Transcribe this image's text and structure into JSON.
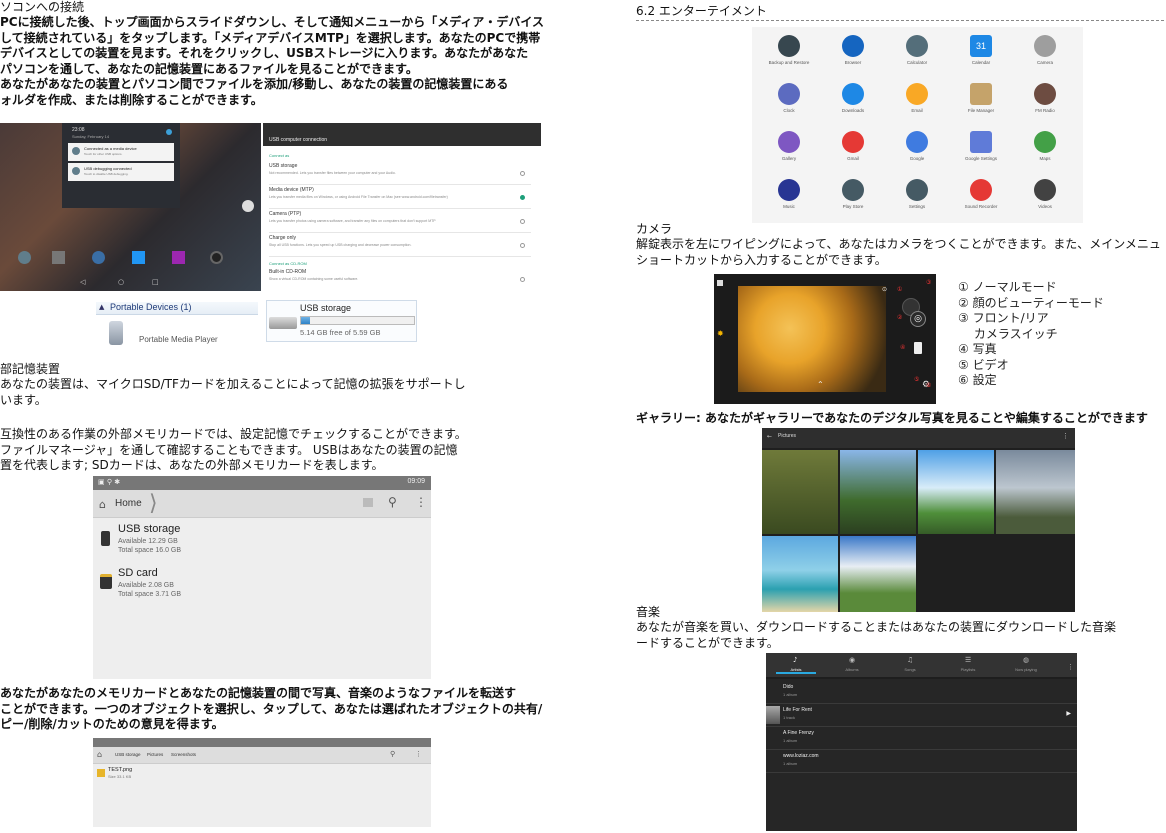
{
  "left": {
    "heading": "ソコンへの接続",
    "intro_lines": [
      "PCに接続した後、トップ画面からスライドダウンし、そして通知メニューから「メディア・デバイス",
      "して接続されている」をタップします。「メディアデバイスMTP」を選択します。あなたのPCで携帯",
      "デバイスとしての装置を見ます。それをクリックし、USBストレージに入ります。あなたがあなた",
      "パソコンを通して、あなたの記憶装置にあるファイルを見ることができます。",
      "あなたがあなたの装置とパソコン間でファイルを添加/移動し、あなたの装置の記憶装置にある",
      "ォルダを作成、または削除することができます。"
    ],
    "notif_screen": {
      "time": "23:08",
      "date": "Sunday, February 14",
      "notif1_title": "Connected as a media device",
      "notif1_sub": "Touch for other USB options.",
      "notif2_title": "USB debugging connected",
      "notif2_sub": "Touch to disable USB debugging."
    },
    "usb_screen": {
      "title": "USB computer connection",
      "section1": "Connect as",
      "options": [
        {
          "title": "USB storage",
          "sub": "Not recommended. Lets you transfer files between your computer and your Audio. ",
          "selected": false
        },
        {
          "title": "Media device (MTP)",
          "sub": "Lets you transfer media files on Windows, or using Android File Transfer on Mac (see www.android.com/filetransfer)",
          "selected": true
        },
        {
          "title": "Camera (PTP)",
          "sub": "Lets you transfer photos using camera software, and transfer any files on computers that don't support MTP",
          "selected": false
        },
        {
          "title": "Charge only",
          "sub": "Stop all USB functions. Lets you speed up USB charging and decrease power consumption.",
          "selected": false
        }
      ],
      "section2": "Connect as CD-ROM",
      "cdrom_title": "Built-in CD-ROM",
      "cdrom_sub": "Show a virtual CD-ROM containing some useful software."
    },
    "explorer": {
      "group_label": "Portable Devices (1)",
      "device_label": "Portable Media Player",
      "storage_label": "USB storage",
      "storage_free": "5.14 GB free of 5.59 GB",
      "storage_used_fraction": 0.08
    },
    "ext_heading": "部記憶装置",
    "ext_lines": [
      "あなたの装置は、マイクロSD/TFカードを加えることによって記憶の拡張をサポートし",
      "います。"
    ],
    "compat_lines": [
      "互換性のある作業の外部メモリカードでは、設定記憶でチェックすることができます。",
      "ファイルマネージャ」を通して確認することもできます。 USBはあなたの装置の記憶",
      "置を代表します; SDカードは、あなたの外部メモリカードを表します。"
    ],
    "filemgr": {
      "status_time": "09:09",
      "home_label": "Home",
      "usb_title": "USB storage",
      "usb_avail": "Available 12.29 GB",
      "usb_total": "Total space 16.0 GB",
      "sd_title": "SD card",
      "sd_avail": "Available 2.08 GB",
      "sd_total": "Total space 3.71 GB"
    },
    "transfer_lines": [
      "あなたがあなたのメモリカードとあなたの記憶装置の間で写真、音楽のようなファイルを転送す",
      "ことができます。一つのオブジェクトを選択し、タップして、あなたは選ばれたオブジェクトの共有/",
      "ピー/削除/カットのための意見を得ます。"
    ],
    "filemgr2": {
      "crumbs": [
        "USB storage",
        "Pictures",
        "Screenshots"
      ],
      "file_name": "TEST.png",
      "file_size": "Size 33.1 KB"
    }
  },
  "right": {
    "section_title": "6.2 エンターテイメント",
    "apps": [
      "Backup and Restore",
      "Browser",
      "Calculator",
      "Calendar",
      "Camera",
      "Clock",
      "Downloads",
      "Email",
      "File Manager",
      "FM Radio",
      "Gallery",
      "Gmail",
      "Google",
      "Google Settings",
      "Maps",
      "Music",
      "Play Store",
      "Settings",
      "Sound Recorder",
      "Videos"
    ],
    "calendar_day": "31",
    "camera_heading": "カメラ",
    "camera_lines": [
      "解錠表示を左にワイピングによって、あなたはカメラをつくことができます。また、メインメニュ",
      "ショートカットから入力することができます。"
    ],
    "camera_legend": [
      "① ノーマルモード",
      "② 顔のビューティーモード",
      "③ フロント/リア",
      "　 カメラスイッチ",
      "④ 写真",
      "⑤ ビデオ",
      "⑥ 設定"
    ],
    "camera_marks": [
      "①",
      "②",
      "③",
      "④",
      "⑤",
      "⑥"
    ],
    "gallery_line": "ギャラリー: あなたがギャラリーであなたのデジタル写真を見ることや編集することができます",
    "gallery_title": "Pictures",
    "music_heading": "音楽",
    "music_lines": [
      "あなたが音楽を買い、ダウンロードすることまたはあなたの装置にダウンロードした音楽",
      "ードすることができます。"
    ],
    "music_tabs": [
      "Artists",
      "Albums",
      "Songs",
      "Playlists",
      "Now playing"
    ],
    "music_rows": [
      {
        "name": "Dido",
        "count": "1 album"
      },
      {
        "name": "Life For Rent",
        "count": "1 track"
      },
      {
        "name": "A Fine Frenzy",
        "count": "1 album"
      },
      {
        "name": "www.loziaz.com",
        "count": "1 album"
      }
    ]
  }
}
